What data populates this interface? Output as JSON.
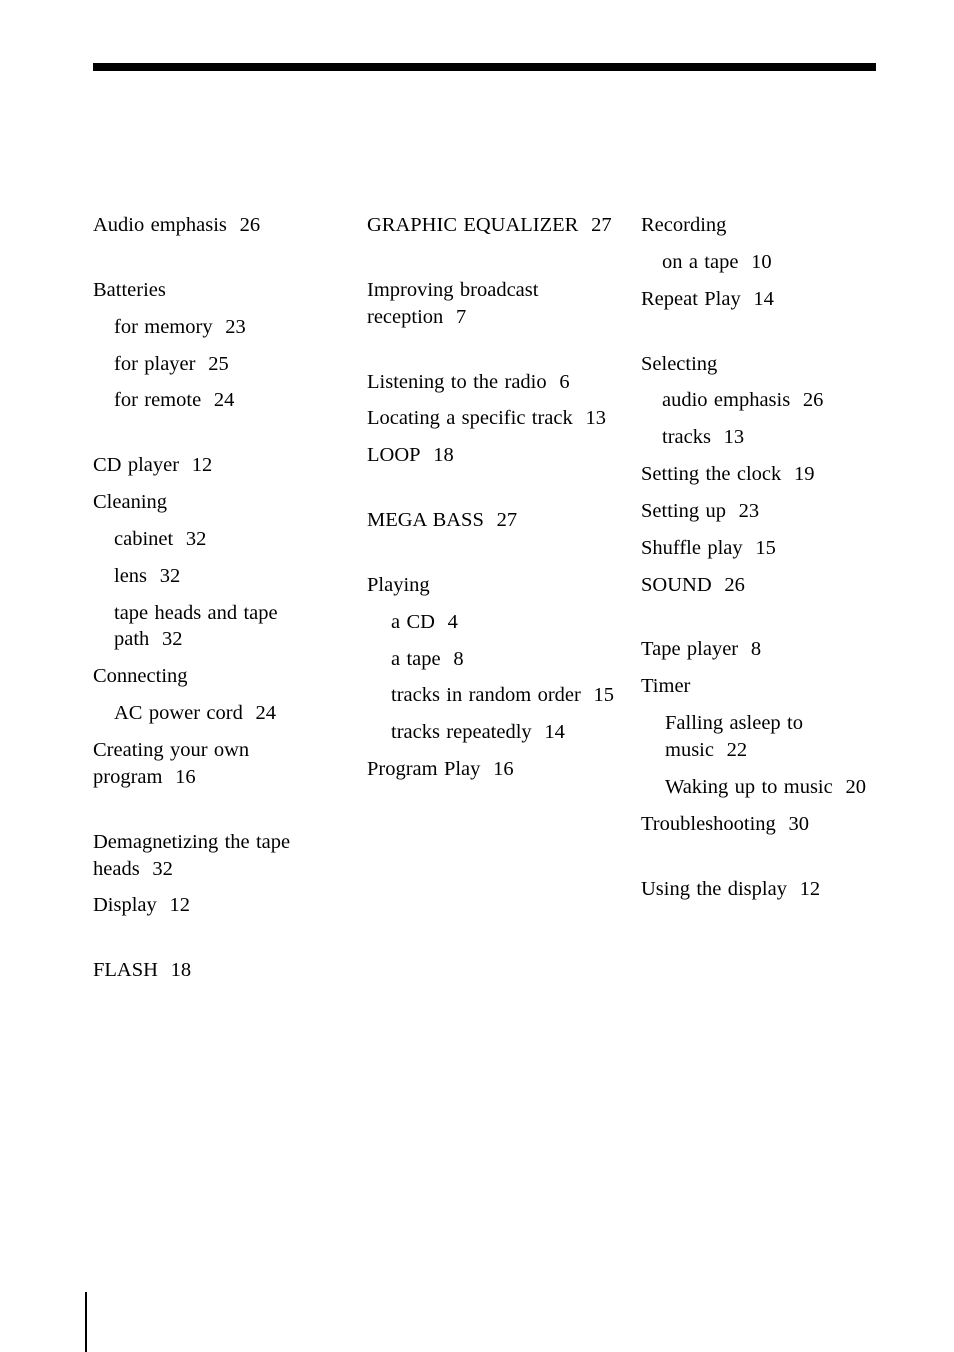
{
  "page": {
    "kind": "book-index",
    "background_color": "#ffffff",
    "text_color": "#000000",
    "header_rule_color": "#000000",
    "footer_rule_color": "#000000"
  },
  "columns": [
    {
      "id": "column-1",
      "groups": [
        {
          "id": "group-a",
          "entries": [
            {
              "level": "top",
              "label": "Audio emphasis",
              "page": "26"
            }
          ]
        },
        {
          "id": "group-b",
          "entries": [
            {
              "level": "top",
              "label": "Batteries",
              "page": ""
            },
            {
              "level": "sub",
              "label": "for memory",
              "page": "23"
            },
            {
              "level": "sub",
              "label": "for player",
              "page": "25"
            },
            {
              "level": "sub",
              "label": "for remote",
              "page": "24"
            }
          ]
        },
        {
          "id": "group-c",
          "entries": [
            {
              "level": "top",
              "label": "CD player",
              "page": "12"
            },
            {
              "level": "top",
              "label": "Cleaning",
              "page": ""
            },
            {
              "level": "sub",
              "label": "cabinet",
              "page": "32"
            },
            {
              "level": "sub",
              "label": "lens",
              "page": "32"
            },
            {
              "level": "sub",
              "label": "tape heads and tape path",
              "page": "32"
            },
            {
              "level": "top",
              "label": "Connecting",
              "page": ""
            },
            {
              "level": "sub",
              "label": "AC power cord",
              "page": "24"
            },
            {
              "level": "top",
              "label": "Creating your own program",
              "page": "16"
            }
          ]
        },
        {
          "id": "group-d",
          "entries": [
            {
              "level": "top",
              "label": "Demagnetizing the tape heads",
              "page": "32"
            },
            {
              "level": "top",
              "label": "Display",
              "page": "12"
            }
          ]
        },
        {
          "id": "group-f",
          "entries": [
            {
              "level": "top",
              "label": "FLASH",
              "page": "18"
            }
          ]
        }
      ]
    },
    {
      "id": "column-2",
      "groups": [
        {
          "id": "group-g",
          "entries": [
            {
              "level": "top",
              "label": "GRAPHIC EQUALIZER",
              "page": "27"
            }
          ]
        },
        {
          "id": "group-i",
          "entries": [
            {
              "level": "top",
              "label": "Improving broadcast reception",
              "page": "7"
            }
          ]
        },
        {
          "id": "group-l",
          "entries": [
            {
              "level": "top",
              "label": "Listening to the radio",
              "page": "6"
            },
            {
              "level": "top",
              "label": "Locating a specific track",
              "page": "13"
            },
            {
              "level": "top",
              "label": "LOOP",
              "page": "18"
            }
          ]
        },
        {
          "id": "group-m",
          "entries": [
            {
              "level": "top",
              "label": "MEGA BASS",
              "page": "27"
            }
          ]
        },
        {
          "id": "group-p",
          "entries": [
            {
              "level": "top",
              "label": "Playing",
              "page": ""
            },
            {
              "level": "sub-deep",
              "label": "a CD",
              "page": "4"
            },
            {
              "level": "sub-deep",
              "label": "a tape",
              "page": "8"
            },
            {
              "level": "sub-deep",
              "label": "tracks in random order",
              "page": "15"
            },
            {
              "level": "sub-deep",
              "label": "tracks repeatedly",
              "page": "14"
            },
            {
              "level": "top",
              "label": "Program Play",
              "page": "16"
            }
          ]
        }
      ]
    },
    {
      "id": "column-3",
      "groups": [
        {
          "id": "group-r",
          "entries": [
            {
              "level": "top",
              "label": "Recording",
              "page": ""
            },
            {
              "level": "sub",
              "label": "on a tape",
              "page": "10"
            },
            {
              "level": "top",
              "label": "Repeat Play",
              "page": "14"
            }
          ]
        },
        {
          "id": "group-s",
          "entries": [
            {
              "level": "top",
              "label": "Selecting",
              "page": ""
            },
            {
              "level": "sub",
              "label": "audio emphasis",
              "page": "26"
            },
            {
              "level": "sub",
              "label": "tracks",
              "page": "13"
            },
            {
              "level": "top",
              "label": "Setting the clock",
              "page": "19"
            },
            {
              "level": "top",
              "label": "Setting up",
              "page": "23"
            },
            {
              "level": "top",
              "label": "Shuffle play",
              "page": "15"
            },
            {
              "level": "top",
              "label": "SOUND",
              "page": "26"
            }
          ]
        },
        {
          "id": "group-t",
          "entries": [
            {
              "level": "top",
              "label": "Tape player",
              "page": "8"
            },
            {
              "level": "top",
              "label": "Timer",
              "page": ""
            },
            {
              "level": "sub-deep",
              "label": "Falling asleep to music",
              "page": "22"
            },
            {
              "level": "sub-deep",
              "label": "Waking up to music",
              "page": "20"
            },
            {
              "level": "top",
              "label": "Troubleshooting",
              "page": "30"
            }
          ]
        },
        {
          "id": "group-u",
          "entries": [
            {
              "level": "top",
              "label": "Using the display",
              "page": "12"
            }
          ]
        }
      ]
    }
  ]
}
